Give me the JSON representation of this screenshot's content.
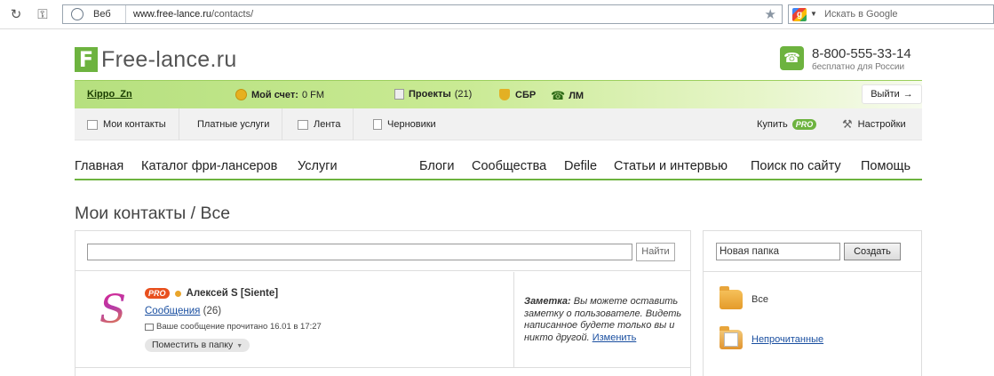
{
  "browser": {
    "mode_label": "Веб",
    "url_host": "www.free-lance.ru",
    "url_path": "/contacts/",
    "search_placeholder": "Искать в Google"
  },
  "header": {
    "logo_letter": "F",
    "logo_text": "Free-lance.ru",
    "phone": "8-800-555-33-14",
    "phone_note": "бесплатно для России"
  },
  "userbar": {
    "username": "Kippo_Zn",
    "account_label": "Мой счет:",
    "account_value": "0 FM",
    "projects_label": "Проекты",
    "projects_count": "(21)",
    "sbr_label": "СБР",
    "lm_label": "ЛМ",
    "exit_label": "Выйти"
  },
  "toolbar": {
    "contacts": "Мои контакты",
    "paid": "Платные услуги",
    "feed": "Лента",
    "drafts": "Черновики",
    "buy": "Купить",
    "pro": "PRO",
    "settings": "Настройки"
  },
  "mainnav": {
    "items": [
      "Главная",
      "Каталог фри-лансеров",
      "Услуги",
      "Блоги",
      "Сообщества",
      "Defile",
      "Статьи и интервью",
      "Поиск по сайту",
      "Помощь"
    ]
  },
  "page": {
    "title": "Мои контакты / Все"
  },
  "search": {
    "find_label": "Найти"
  },
  "contact": {
    "avatar_letter": "S",
    "pro": "PRO",
    "name": "Алексей S [Siente]",
    "messages_link": "Сообщения",
    "messages_count": "(26)",
    "read_status": "Ваше сообщение прочитано 16.01 в 17:27",
    "move_label": "Поместить в папку",
    "note_label": "Заметка:",
    "note_text": "Вы можете оставить заметку о пользователе. Видеть написанное будете только вы и никто другой.",
    "note_edit": "Изменить"
  },
  "folders": {
    "new_folder_value": "Новая папка",
    "create_label": "Создать",
    "items": [
      "Все",
      "Непрочитанные"
    ]
  },
  "colors": {
    "brand_green": "#6db33f",
    "pro_red": "#e8501e",
    "link_blue": "#1a4fa0"
  }
}
